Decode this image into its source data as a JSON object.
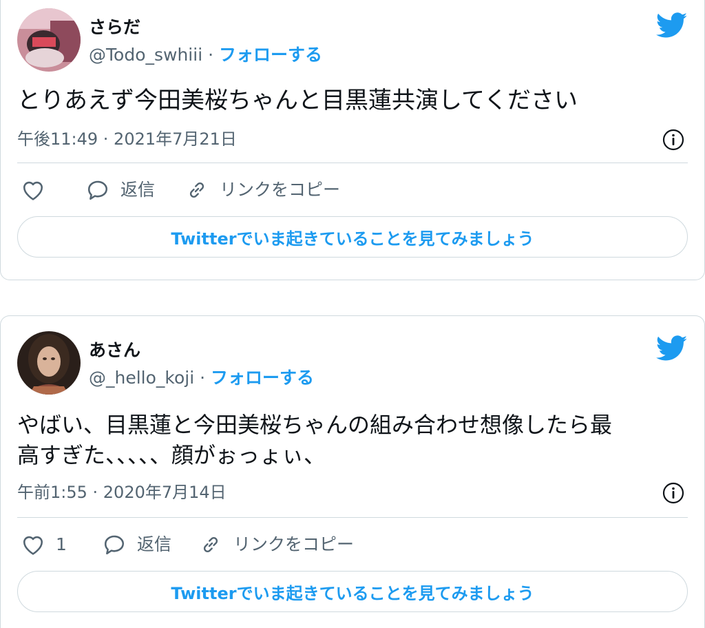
{
  "tweets": [
    {
      "name": "さらだ",
      "handle": "@Todo_swhiii",
      "separator": " · ",
      "follow_label": "フォローする",
      "text": "とりあえず今田美桜ちゃんと目黒蓮共演してください",
      "timestamp": "午後11:49 · 2021年7月21日",
      "like_count": "",
      "reply_label": "返信",
      "copy_link_label": "リンクをコピー",
      "cta_label": "Twitterでいま起きていることを見てみましょう"
    },
    {
      "name": "あさん",
      "handle": "@_hello_koji",
      "separator": " · ",
      "follow_label": "フォローする",
      "text_line1": "やばい、目黒蓮と今田美桜ちゃんの組み合わせ想像したら最",
      "text_line2": "高すぎた、、、、、顔がぉっょぃ、",
      "timestamp": "午前1:55 · 2020年7月14日",
      "like_count": "1",
      "reply_label": "返信",
      "copy_link_label": "リンクをコピー",
      "cta_label": "Twitterでいま起きていることを見てみましょう"
    }
  ],
  "icons": {
    "bird": "twitter-bird-icon",
    "info": "info-icon",
    "like": "heart-icon",
    "reply": "speech-bubble-icon",
    "link": "link-icon"
  },
  "colors": {
    "accent": "#1d9bf0",
    "text": "#0f1419",
    "secondary": "#536471",
    "border": "#cfd9de"
  }
}
